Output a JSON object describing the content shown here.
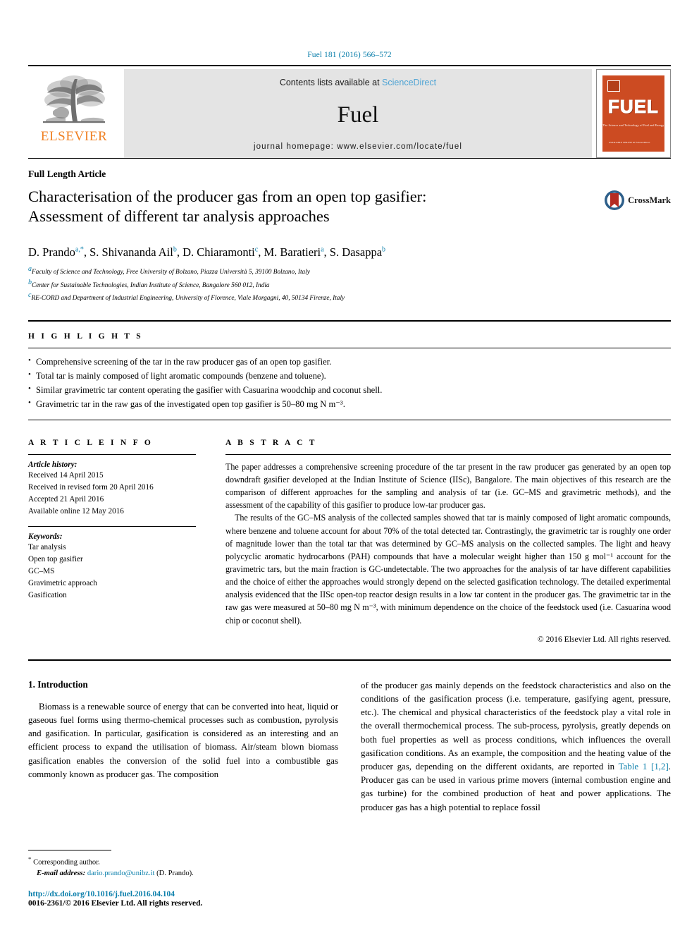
{
  "running_head": "Fuel 181 (2016) 566–572",
  "masthead": {
    "publisher_name": "ELSEVIER",
    "contents_prefix": "Contents lists available at ",
    "sciencedirect": "ScienceDirect",
    "journal_name": "Fuel",
    "homepage": "journal homepage: www.elsevier.com/locate/fuel",
    "cover_title": "FUEL",
    "cover_subtitle": "The Science and Technology of Fuel and Energy",
    "cover_footer": "AVAILABLE ONLINE AT\nScienceDirect",
    "accent_orange": "#f08124",
    "accent_blue": "#0b7fab",
    "cover_red": "#cc4b22",
    "band_grey": "#e4e4e4"
  },
  "article": {
    "type": "Full Length Article",
    "title_line1": "Characterisation of the producer gas from an open top gasifier:",
    "title_line2": "Assessment of different tar analysis approaches",
    "crossmark_label": "CrossMark",
    "authors": [
      {
        "name": "D. Prando",
        "sup": "a,*"
      },
      {
        "name": "S. Shivananda Ail",
        "sup": "b"
      },
      {
        "name": "D. Chiaramonti",
        "sup": "c"
      },
      {
        "name": "M. Baratieri",
        "sup": "a"
      },
      {
        "name": "S. Dasappa",
        "sup": "b"
      }
    ],
    "affiliations": [
      {
        "sup": "a",
        "text": "Faculty of Science and Technology, Free University of Bolzano, Piazza Università 5, 39100 Bolzano, Italy"
      },
      {
        "sup": "b",
        "text": "Center for Sustainable Technologies, Indian Institute of Science, Bangalore 560 012, India"
      },
      {
        "sup": "c",
        "text": "RE-CORD and Department of Industrial Engineering, University of Florence, Viale Morgagni, 40, 50134 Firenze, Italy"
      }
    ]
  },
  "highlights": {
    "label": "H I G H L I G H T S",
    "items": [
      "Comprehensive screening of the tar in the raw producer gas of an open top gasifier.",
      "Total tar is mainly composed of light aromatic compounds (benzene and toluene).",
      "Similar gravimetric tar content operating the gasifier with Casuarina woodchip and coconut shell.",
      "Gravimetric tar in the raw gas of the investigated open top gasifier is 50–80 mg N m⁻³."
    ]
  },
  "article_info": {
    "label": "A R T I C L E   I N F O",
    "history_title": "Article history:",
    "history": [
      "Received 14 April 2015",
      "Received in revised form 20 April 2016",
      "Accepted 21 April 2016",
      "Available online 12 May 2016"
    ],
    "keywords_title": "Keywords:",
    "keywords": [
      "Tar analysis",
      "Open top gasifier",
      "GC–MS",
      "Gravimetric approach",
      "Gasification"
    ]
  },
  "abstract": {
    "label": "A B S T R A C T",
    "paragraphs": [
      "The paper addresses a comprehensive screening procedure of the tar present in the raw producer gas generated by an open top downdraft gasifier developed at the Indian Institute of Science (IISc), Bangalore. The main objectives of this research are the comparison of different approaches for the sampling and analysis of tar (i.e. GC–MS and gravimetric methods), and the assessment of the capability of this gasifier to produce low-tar producer gas.",
      "The results of the GC–MS analysis of the collected samples showed that tar is mainly composed of light aromatic compounds, where benzene and toluene account for about 70% of the total detected tar. Contrastingly, the gravimetric tar is roughly one order of magnitude lower than the total tar that was determined by GC–MS analysis on the collected samples. The light and heavy polycyclic aromatic hydrocarbons (PAH) compounds that have a molecular weight higher than 150 g mol⁻¹ account for the gravimetric tars, but the main fraction is GC-undetectable. The two approaches for the analysis of tar have different capabilities and the choice of either the approaches would strongly depend on the selected gasification technology. The detailed experimental analysis evidenced that the IISc open-top reactor design results in a low tar content in the producer gas. The gravimetric tar in the raw gas were measured at 50–80 mg N m⁻³, with minimum dependence on the choice of the feedstock used (i.e. Casuarina wood chip or coconut shell)."
    ],
    "copyright": "© 2016 Elsevier Ltd. All rights reserved."
  },
  "body": {
    "section_heading": "1. Introduction",
    "left_paragraph": "Biomass is a renewable source of energy that can be converted into heat, liquid or gaseous fuel forms using thermo-chemical processes such as combustion, pyrolysis and gasification. In particular, gasification is considered as an interesting and an efficient process to expand the utilisation of biomass. Air/steam blown biomass gasification enables the conversion of the solid fuel into a combustible gas commonly known as producer gas. The composition",
    "right_paragraph_pre": "of the producer gas mainly depends on the feedstock characteristics and also on the conditions of the gasification process (i.e. temperature, gasifying agent, pressure, etc.). The chemical and physical characteristics of the feedstock play a vital role in the overall thermochemical process. The sub-process, pyrolysis, greatly depends on both fuel properties as well as process conditions, which influences the overall gasification conditions. As an example, the composition and the heating value of the producer gas, depending on the different oxidants, are reported in ",
    "right_link": "Table 1 [1,2]",
    "right_paragraph_post": ". Producer gas can be used in various prime movers (internal combustion engine and gas turbine) for the combined production of heat and power applications. The producer gas has a high potential to replace fossil"
  },
  "footnote": {
    "corresponding": "Corresponding author.",
    "email_label": "E-mail address:",
    "email": "dario.prando@unibz.it",
    "email_owner": "(D. Prando).",
    "doi": "http://dx.doi.org/10.1016/j.fuel.2016.04.104",
    "issn_line": "0016-2361/© 2016 Elsevier Ltd. All rights reserved."
  }
}
